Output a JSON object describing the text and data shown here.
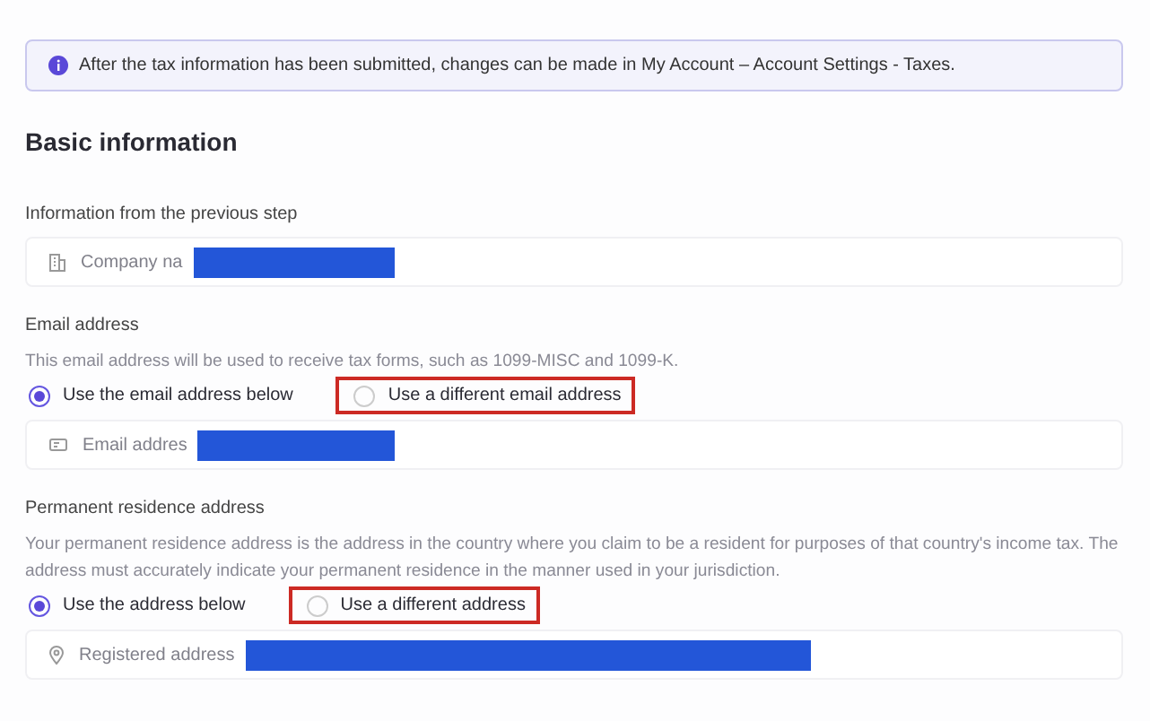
{
  "notice": {
    "text": "After the tax information has been submitted, changes can be made in My Account – Account Settings - Taxes."
  },
  "section_title": "Basic information",
  "groups": [
    {
      "title": "Information from the previous step",
      "field": {
        "value": "Company na",
        "redacted": true
      }
    },
    {
      "title": "Email address",
      "description": "This email address will be used to receive tax forms, such as 1099-MISC and 1099-K.",
      "options": [
        {
          "label": "Use the email address below",
          "selected": true,
          "highlighted": false
        },
        {
          "label": "Use a different email address",
          "selected": false,
          "highlighted": true
        }
      ],
      "field": {
        "value": "Email addres",
        "redacted": true
      }
    },
    {
      "title": "Permanent residence address",
      "description": "Your permanent residence address is the address in the country where you claim to be a resident for purposes of that country's income tax. The address must accurately indicate your permanent residence in the manner used in your jurisdiction.",
      "options": [
        {
          "label": "Use the address below",
          "selected": true,
          "highlighted": false
        },
        {
          "label": "Use a different address",
          "selected": false,
          "highlighted": true
        }
      ],
      "field": {
        "value": "Registered address",
        "redacted": true
      }
    }
  ]
}
